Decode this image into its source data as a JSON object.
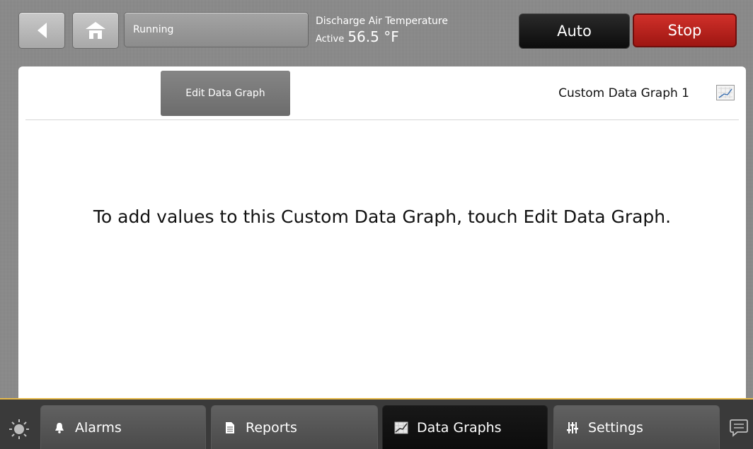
{
  "header": {
    "back_icon": "back-arrow-icon",
    "home_icon": "home-icon",
    "status_button_label": "Running",
    "point_name": "Discharge Air Temperature",
    "point_state": "Active",
    "point_value": "56.5 °F",
    "mode_label": "Auto",
    "stop_label": "Stop",
    "stop_color": "#c0241f"
  },
  "main": {
    "edit_button_label": "Edit Data Graph",
    "graph_title": "Custom Data Graph 1",
    "graph_icon": "line-chart-icon",
    "empty_message": "To add values to this Custom Data Graph, touch Edit Data Graph."
  },
  "footer": {
    "accent_color": "#e6b94a",
    "brightness_icon": "sun-icon",
    "tabs": [
      {
        "label": "Alarms",
        "icon": "bell-icon",
        "active": false
      },
      {
        "label": "Reports",
        "icon": "document-icon",
        "active": false
      },
      {
        "label": "Data Graphs",
        "icon": "chart-icon",
        "active": true
      },
      {
        "label": "Settings",
        "icon": "sliders-icon",
        "active": false
      }
    ],
    "message_icon": "chat-bubble-icon"
  }
}
